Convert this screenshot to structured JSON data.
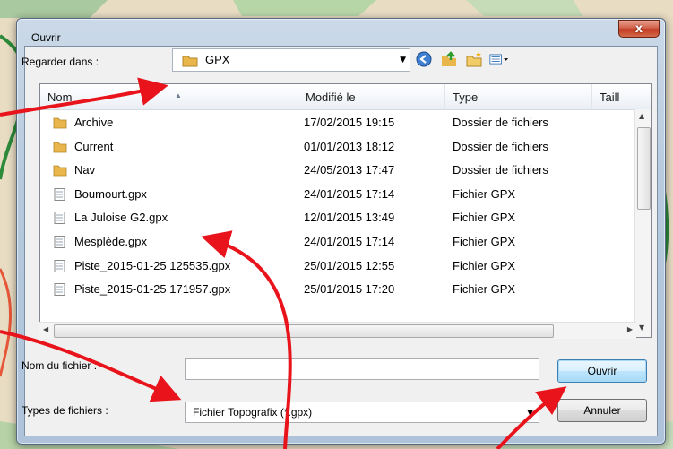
{
  "window": {
    "title": "Ouvrir",
    "close_label": "x"
  },
  "lookin": {
    "label": "Regarder dans :",
    "value": "GPX"
  },
  "columns": [
    {
      "label": "Nom"
    },
    {
      "label": "Modifié le"
    },
    {
      "label": "Type"
    },
    {
      "label": "Taill"
    }
  ],
  "files": [
    {
      "name": "Archive",
      "modified": "17/02/2015 19:15",
      "type": "Dossier de fichiers",
      "kind": "folder"
    },
    {
      "name": "Current",
      "modified": "01/01/2013 18:12",
      "type": "Dossier de fichiers",
      "kind": "folder"
    },
    {
      "name": "Nav",
      "modified": "24/05/2013 17:47",
      "type": "Dossier de fichiers",
      "kind": "folder"
    },
    {
      "name": "Boumourt.gpx",
      "modified": "24/01/2015 17:14",
      "type": "Fichier GPX",
      "kind": "file"
    },
    {
      "name": "La Juloise G2.gpx",
      "modified": "12/01/2015 13:49",
      "type": "Fichier GPX",
      "kind": "file"
    },
    {
      "name": "Mesplède.gpx",
      "modified": "24/01/2015 17:14",
      "type": "Fichier GPX",
      "kind": "file"
    },
    {
      "name": "Piste_2015-01-25 125535.gpx",
      "modified": "25/01/2015 12:55",
      "type": "Fichier GPX",
      "kind": "file"
    },
    {
      "name": "Piste_2015-01-25 171957.gpx",
      "modified": "25/01/2015 17:20",
      "type": "Fichier GPX",
      "kind": "file"
    }
  ],
  "filename": {
    "label": "Nom du fichier :",
    "value": ""
  },
  "filetype": {
    "label": "Types de fichiers :",
    "value": "Fichier Topografix (*.gpx)"
  },
  "buttons": {
    "open": "Ouvrir",
    "cancel": "Annuler"
  },
  "colors": {
    "accent": "#3c7fb1",
    "arrow": "#e8131b",
    "folder": "#e8b64a"
  }
}
